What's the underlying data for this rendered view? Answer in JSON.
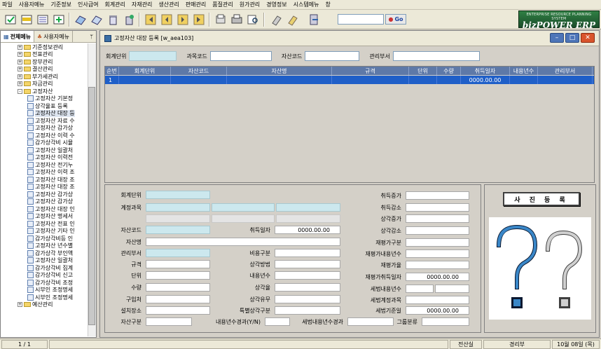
{
  "menubar": {
    "items": [
      "파일",
      "사용자메뉴",
      "기준정보",
      "인사급여",
      "회계관리",
      "자재관리",
      "생산관리",
      "판매관리",
      "품질관리",
      "원가관리",
      "경영정보",
      "시스템메뉴",
      "창"
    ]
  },
  "toolbar": {
    "search": {
      "value": "",
      "placeholder": ""
    },
    "go_label": "Go"
  },
  "brand": {
    "subtitle": "ENTERPRISE RESOURCE PLANNING SYSTEM",
    "name": "bizPOWER ERP"
  },
  "sidebar": {
    "tabs": [
      "전체메뉴",
      "사용자메뉴"
    ],
    "pin": "ᛘ",
    "tree": [
      {
        "label": "기준정보관리",
        "level": 1,
        "type": "folder",
        "exp": "+"
      },
      {
        "label": "전표관리",
        "level": 1,
        "type": "folder",
        "exp": "+"
      },
      {
        "label": "장부관리",
        "level": 1,
        "type": "folder",
        "exp": "+"
      },
      {
        "label": "결산관리",
        "level": 1,
        "type": "folder",
        "exp": "+"
      },
      {
        "label": "부가세관리",
        "level": 1,
        "type": "folder",
        "exp": "+"
      },
      {
        "label": "자금관리",
        "level": 1,
        "type": "folder",
        "exp": "+"
      },
      {
        "label": "고정자산",
        "level": 1,
        "type": "folder",
        "exp": "-"
      },
      {
        "label": "고정자산 기본정",
        "level": 2,
        "type": "doc"
      },
      {
        "label": "상각율표 등록",
        "level": 2,
        "type": "doc"
      },
      {
        "label": "고정자산 대장 등",
        "level": 2,
        "type": "doc",
        "selected": true
      },
      {
        "label": "고정자산 자료 수",
        "level": 2,
        "type": "doc"
      },
      {
        "label": "고정자산 감가상",
        "level": 2,
        "type": "doc"
      },
      {
        "label": "고정자산 이력 수",
        "level": 2,
        "type": "doc"
      },
      {
        "label": "감가상각비 시뮬",
        "level": 2,
        "type": "doc"
      },
      {
        "label": "고정자산 일괄처",
        "level": 2,
        "type": "doc"
      },
      {
        "label": "고정자산 이력전",
        "level": 2,
        "type": "doc"
      },
      {
        "label": "고정자산 전기누",
        "level": 2,
        "type": "doc"
      },
      {
        "label": "고정자산 이력 조",
        "level": 2,
        "type": "doc"
      },
      {
        "label": "고정자산 대장 조",
        "level": 2,
        "type": "doc"
      },
      {
        "label": "고정자산 대장 조",
        "level": 2,
        "type": "doc"
      },
      {
        "label": "고정자산 감가상",
        "level": 2,
        "type": "doc"
      },
      {
        "label": "고정자산 감가상",
        "level": 2,
        "type": "doc"
      },
      {
        "label": "고정자산 대장 인",
        "level": 2,
        "type": "doc"
      },
      {
        "label": "고정자산 명세서",
        "level": 2,
        "type": "doc"
      },
      {
        "label": "고정자산 전표 인",
        "level": 2,
        "type": "doc"
      },
      {
        "label": "고정자산 기타 인",
        "level": 2,
        "type": "doc"
      },
      {
        "label": "감가상각비등 인",
        "level": 2,
        "type": "doc"
      },
      {
        "label": "고정자산 년수별",
        "level": 2,
        "type": "doc"
      },
      {
        "label": "감가상각 부인액",
        "level": 2,
        "type": "doc"
      },
      {
        "label": "고정자산 일괄처",
        "level": 2,
        "type": "doc"
      },
      {
        "label": "감가상각비 집계",
        "level": 2,
        "type": "doc"
      },
      {
        "label": "감가상각비 신고",
        "level": 2,
        "type": "doc"
      },
      {
        "label": "감가상각비 조정",
        "level": 2,
        "type": "doc"
      },
      {
        "label": "시부인 조정명세",
        "level": 2,
        "type": "doc"
      },
      {
        "label": "시부인 조정명세",
        "level": 2,
        "type": "doc"
      },
      {
        "label": "예산관리",
        "level": 1,
        "type": "folder",
        "exp": "+"
      }
    ]
  },
  "window": {
    "title": "고정자산 대장 등록 [w_aea103]"
  },
  "condition": {
    "labels": [
      "회계단위",
      "과목코드",
      "자산코드",
      "관리부서"
    ]
  },
  "grid": {
    "columns": [
      "순번",
      "회계단위",
      "자산코드",
      "자산명",
      "규격",
      "단위",
      "수량",
      "취득일자",
      "내용년수",
      "관리부서"
    ],
    "rows": [
      [
        "1",
        "",
        "",
        "",
        "",
        "",
        "",
        "0000.00.00",
        "",
        ""
      ]
    ]
  },
  "detail": {
    "labels": {
      "accounting_unit": "회계단위",
      "account_subject": "계정과목",
      "asset_code": "자산코드",
      "asset_name": "자산명",
      "dept": "관리부서",
      "spec": "규격",
      "unit": "단위",
      "qty": "수량",
      "purchase_place": "구입처",
      "location": "설치장소",
      "asset_type": "자산구분",
      "acq_date": "취득일자",
      "cost_type": "비용구분",
      "dep_method": "상각방법",
      "useful_life": "내용년수",
      "dep_rate": "상각율",
      "dep_reason": "상각유무",
      "special_dep": "특별상각구분",
      "acq_inc": "취득증가",
      "acq_dec": "취득감소",
      "dep_inc": "상각증가",
      "dep_dec": "상각감소",
      "reval_type": "재평가구분",
      "reval_life": "재평가내용년수",
      "reval_amount": "재평가율",
      "reval_acq_date": "재평가취득일자",
      "tax_life": "세법내용년수",
      "tax_account": "세법계정과목",
      "tax_base_date": "세법기준일",
      "life_elapsed": "내용년수경과(Y/N)",
      "tax_life_elapsed": "세법내용년수경과",
      "group_class": "그룹분류"
    },
    "values": {
      "acq_date": "0000.00.00",
      "reval_acq_date": "0000.00.00",
      "tax_base_date": "0000.00.00"
    }
  },
  "photo": {
    "button_label": "사 진 등 록"
  },
  "statusbar": {
    "page": "1 / 1",
    "dept": "전산실",
    "user": "경리부",
    "date": "10월 08일 (목)"
  },
  "colors": {
    "grid_header": "#5e79a8",
    "grid_selected": "#1f5fc8",
    "required_field": "#cce8ee",
    "brand": "#2f7f44"
  }
}
